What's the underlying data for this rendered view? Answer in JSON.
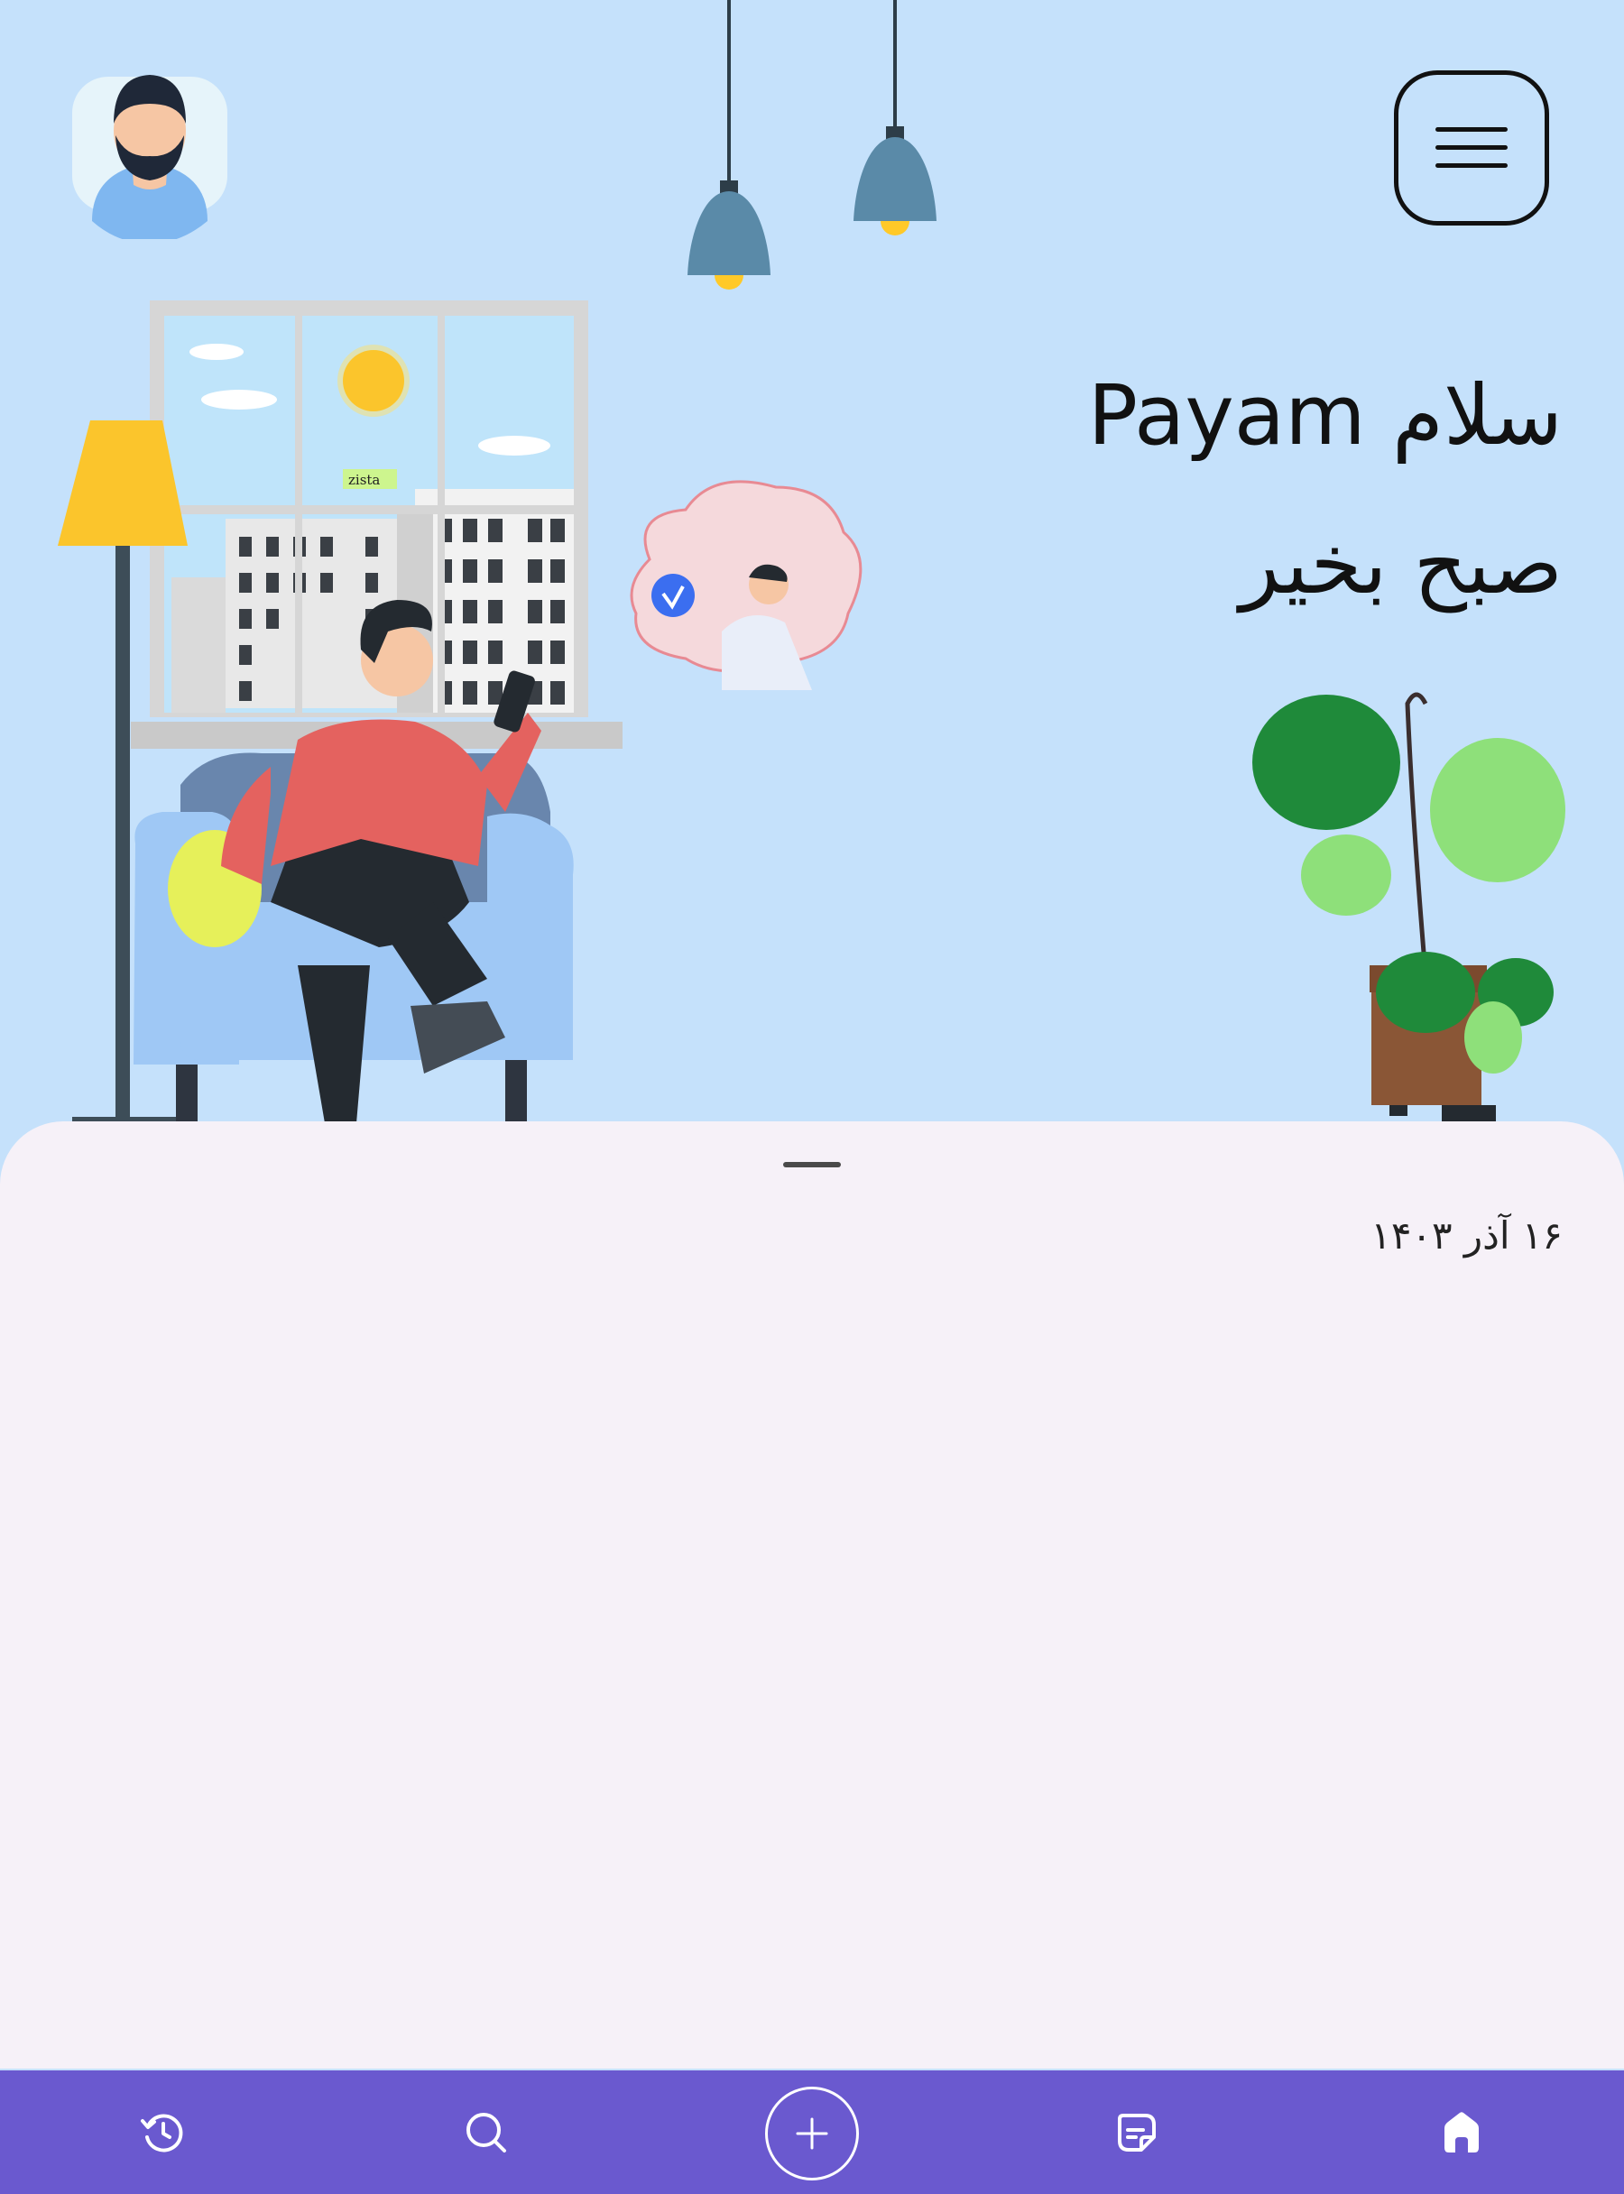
{
  "header": {
    "greeting_line1": "سلام Payam",
    "greeting_line2": "صبح بخیر",
    "menu_icon": "hamburger-menu-icon",
    "avatar_icon": "user-avatar"
  },
  "illustration": {
    "building_sign": "zista"
  },
  "sheet": {
    "date": "۱۶ آذر ۱۴۰۳"
  },
  "bottom_nav": {
    "items": [
      {
        "icon": "history-icon"
      },
      {
        "icon": "search-icon"
      },
      {
        "icon": "plus-icon"
      },
      {
        "icon": "document-icon"
      },
      {
        "icon": "home-icon",
        "active": true
      }
    ],
    "background": "#6a59cf"
  },
  "colors": {
    "hero_background": "#c5e1fb",
    "sheet_background": "#f6f1f8",
    "nav_background": "#6a59cf"
  }
}
